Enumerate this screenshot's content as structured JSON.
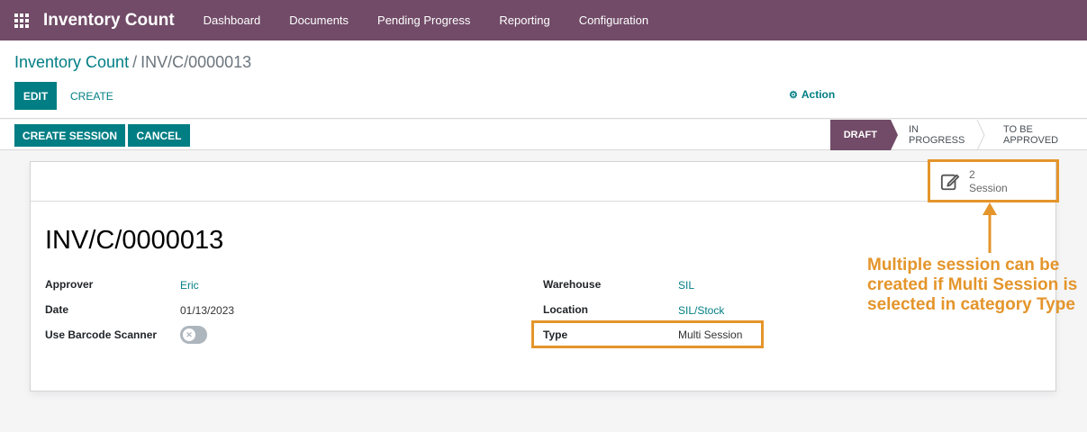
{
  "navbar": {
    "app_title": "Inventory Count",
    "menu": [
      {
        "label": "Dashboard"
      },
      {
        "label": "Documents"
      },
      {
        "label": "Pending Progress"
      },
      {
        "label": "Reporting"
      },
      {
        "label": "Configuration"
      }
    ],
    "apps_icon": "grid-icon"
  },
  "breadcrumb": {
    "parent": "Inventory Count",
    "separator": "/",
    "current": "INV/C/0000013"
  },
  "control": {
    "edit_label": "EDIT",
    "create_label": "CREATE",
    "action_label": "Action",
    "action_icon": "gear-icon"
  },
  "statusbar": {
    "create_session_label": "CREATE SESSION",
    "cancel_label": "CANCEL",
    "stages": [
      {
        "label": "DRAFT",
        "active": true
      },
      {
        "label": "IN PROGRESS",
        "active": false
      },
      {
        "label": "TO BE APPROVED",
        "active": false
      }
    ]
  },
  "smart_button": {
    "count": "2",
    "label": "Session",
    "icon": "edit-icon"
  },
  "form": {
    "title": "INV/C/0000013",
    "left_fields": [
      {
        "label": "Approver",
        "value": "Eric"
      },
      {
        "label": "Date",
        "value": "01/13/2023"
      },
      {
        "label": "Use Barcode Scanner",
        "value": false
      }
    ],
    "right_fields": [
      {
        "label": "Warehouse",
        "value": "SIL"
      },
      {
        "label": "Location",
        "value": "SIL/Stock"
      },
      {
        "label": "Type",
        "value": "Multi Session"
      }
    ]
  },
  "annotation": {
    "text": "Multiple session can be created if Multi Session is selected in category Type",
    "color": "#e4952b"
  },
  "colors": {
    "brand": "#714b67",
    "accent": "#017e84",
    "annotation": "#e4952b"
  }
}
